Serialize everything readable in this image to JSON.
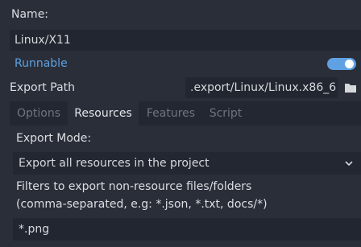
{
  "name": {
    "label": "Name:",
    "value": "Linux/X11"
  },
  "runnable": {
    "label": "Runnable",
    "enabled": true,
    "color": "#5fa1e2"
  },
  "export_path": {
    "label": "Export Path",
    "value": ".export/Linux/Linux.x86_6",
    "icon": "folder-icon"
  },
  "tabs": [
    {
      "label": "Options",
      "active": false
    },
    {
      "label": "Resources",
      "active": true
    },
    {
      "label": "Features",
      "active": false
    },
    {
      "label": "Script",
      "active": false
    }
  ],
  "resources": {
    "export_mode_label": "Export Mode:",
    "export_mode_value": "Export all resources in the project",
    "filters_label_line1": "Filters to export non-resource files/folders",
    "filters_label_line2": "(comma-separated, e.g: *.json, *.txt, docs/*)",
    "filters_value": "*.png"
  }
}
